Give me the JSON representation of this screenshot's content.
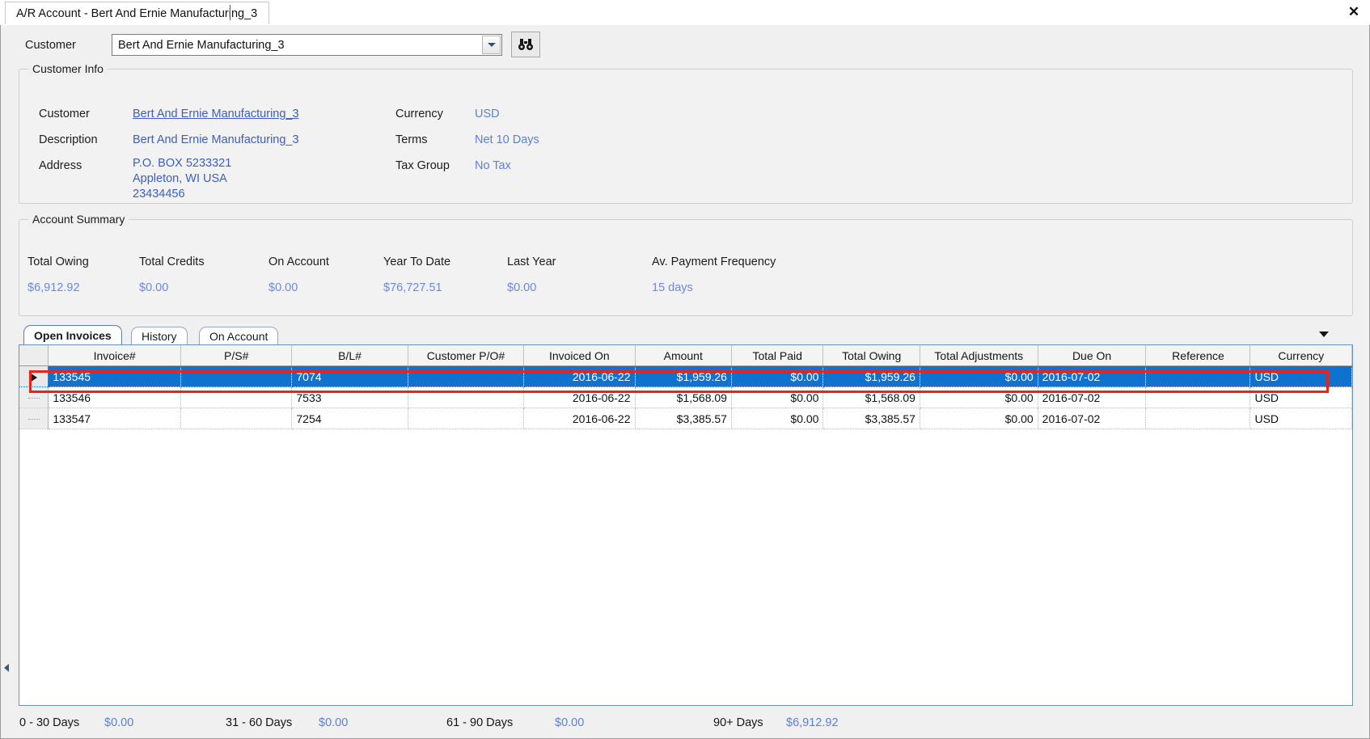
{
  "window": {
    "tab_title": "A/R Account - Bert And Ernie Manufacturing_3",
    "close_label": "✕"
  },
  "selector": {
    "label": "Customer",
    "value": "Bert And Ernie Manufacturing_3",
    "dropdown_icon": "chevron-down-icon",
    "search_icon": "binoculars-icon"
  },
  "customer_info": {
    "group_title": "Customer Info",
    "fields": [
      {
        "label": "Customer",
        "value": "Bert And Ernie Manufacturing_3"
      },
      {
        "label": "Description",
        "value": "Bert And Ernie Manufacturing_3"
      },
      {
        "label": "Address",
        "value": "P.O. BOX 5233321\nAppleton, WI USA\n23434456"
      },
      {
        "label": "Currency",
        "value": "USD"
      },
      {
        "label": "Terms",
        "value": "Net 10 Days"
      },
      {
        "label": "Tax Group",
        "value": "No Tax"
      }
    ]
  },
  "account_summary": {
    "group_title": "Account Summary",
    "items": [
      {
        "label": "Total Owing",
        "value": "$6,912.92"
      },
      {
        "label": "Total Credits",
        "value": "$0.00"
      },
      {
        "label": "On Account",
        "value": "$0.00"
      },
      {
        "label": "Year To Date",
        "value": "$76,727.51"
      },
      {
        "label": "Last Year",
        "value": "$0.00"
      },
      {
        "label": "Av. Payment Frequency",
        "value": "15 days"
      }
    ]
  },
  "tabs": [
    {
      "label": "Open Invoices",
      "active": true
    },
    {
      "label": "History",
      "active": false
    },
    {
      "label": "On Account",
      "active": false
    }
  ],
  "grid": {
    "columns": [
      "Invoice#",
      "P/S#",
      "B/L#",
      "Customer P/O#",
      "Invoiced On",
      "Amount",
      "Total Paid",
      "Total Owing",
      "Total Adjustments",
      "Due On",
      "Reference",
      "Currency"
    ],
    "rows": [
      {
        "selected": true,
        "invoice": "133545",
        "ps": "",
        "bl": "7074",
        "po": "",
        "invoiced_on": "2016-06-22",
        "amount": "$1,959.26",
        "total_paid": "$0.00",
        "total_owing": "$1,959.26",
        "total_adjustments": "$0.00",
        "due_on": "2016-07-02",
        "reference": "",
        "currency": "USD",
        "overdue": true
      },
      {
        "selected": false,
        "invoice": "133546",
        "ps": "",
        "bl": "7533",
        "po": "",
        "invoiced_on": "2016-06-22",
        "amount": "$1,568.09",
        "total_paid": "$0.00",
        "total_owing": "$1,568.09",
        "total_adjustments": "$0.00",
        "due_on": "2016-07-02",
        "reference": "",
        "currency": "USD",
        "overdue": true
      },
      {
        "selected": false,
        "invoice": "133547",
        "ps": "",
        "bl": "7254",
        "po": "",
        "invoiced_on": "2016-06-22",
        "amount": "$3,385.57",
        "total_paid": "$0.00",
        "total_owing": "$3,385.57",
        "total_adjustments": "$0.00",
        "due_on": "2016-07-02",
        "reference": "",
        "currency": "USD",
        "overdue": true
      }
    ]
  },
  "aging": [
    {
      "label": "0 - 30 Days",
      "value": "$0.00"
    },
    {
      "label": "31 - 60 Days",
      "value": "$0.00"
    },
    {
      "label": "61 - 90 Days",
      "value": "$0.00"
    },
    {
      "label": "90+ Days",
      "value": "$6,912.92"
    }
  ],
  "colors": {
    "selection_blue": "#0f72cf",
    "link_blue": "#3b5fc0",
    "value_blue": "#5c7fd8",
    "focus_red": "#e8241a",
    "overdue_red": "#c0392b"
  }
}
